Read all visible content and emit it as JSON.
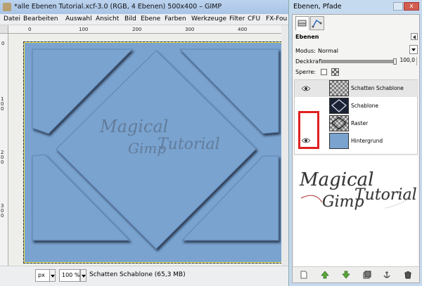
{
  "window": {
    "title": "*alle Ebenen Tutorial.xcf-3.0 (RGB, 4 Ebenen) 500x400 – GIMP"
  },
  "menu": [
    "Datei",
    "Bearbeiten",
    "Auswahl",
    "Ansicht",
    "Bild",
    "Ebene",
    "Farben",
    "Werkzeuge",
    "Filter",
    "CFU",
    "FX-Fou"
  ],
  "rulers": {
    "top": [
      "0",
      "100",
      "200",
      "300",
      "400"
    ],
    "left": [
      "0",
      "100",
      "200",
      "300"
    ]
  },
  "canvas": {
    "image_color": "#7aa3cf",
    "watermark": [
      "Magical",
      "Gimp",
      "Tutorial"
    ]
  },
  "statusbar": {
    "unit": "px",
    "zoom": "100 %",
    "text": "Schatten Schablone (65,3 MB)"
  },
  "dock": {
    "title": "Ebenen, Pfade",
    "close_label": "x",
    "panel_title": "Ebenen",
    "mode_label": "Modus:",
    "mode_value": "Normal",
    "opacity_label": "Deckkraft:",
    "opacity_value": "100,0",
    "opacity_fraction": 1.0,
    "lock_label": "Sperre:",
    "layers": [
      {
        "name": "Schatten Schablone",
        "visible": false,
        "thumb": "checker",
        "selected": true
      },
      {
        "name": "Schablone",
        "visible": false,
        "thumb": "dark",
        "selected": false
      },
      {
        "name": "Raster",
        "visible": false,
        "thumb": "raster",
        "selected": false
      },
      {
        "name": "Hintergrund",
        "visible": true,
        "thumb": "blue",
        "selected": false
      }
    ],
    "preview_text": [
      "Magical",
      "Gimp",
      "Tutorial"
    ],
    "highlight_color": "#e02020"
  }
}
